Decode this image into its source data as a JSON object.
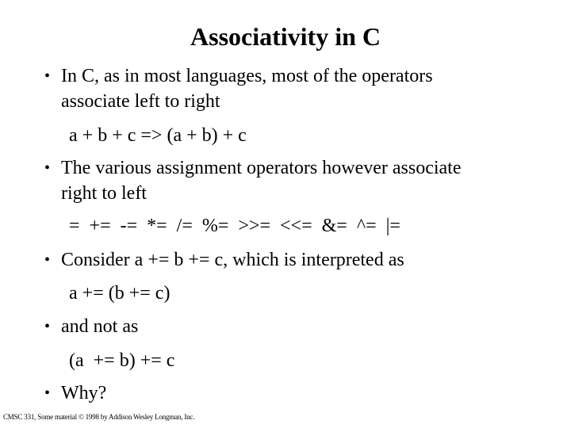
{
  "slide": {
    "title": "Associativity in C",
    "bullet_glyph": "•",
    "items": [
      {
        "type": "bullet",
        "lines": [
          "In C, as in most languages, most of the operators",
          "associate left to right"
        ]
      },
      {
        "type": "code",
        "text": "a + b + c => (a + b) + c"
      },
      {
        "type": "bullet",
        "lines": [
          "The various assignment operators however associate",
          "right to left"
        ]
      },
      {
        "type": "code",
        "text": "=  +=  -=  *=  /=  %=  >>=  <<=  &=  ^=  |="
      },
      {
        "type": "bullet",
        "lines": [
          "Consider a += b += c, which is interpreted as"
        ]
      },
      {
        "type": "code",
        "text": "a += (b += c)"
      },
      {
        "type": "bullet",
        "lines": [
          "and not as"
        ]
      },
      {
        "type": "code",
        "text": "(a  += b) += c"
      },
      {
        "type": "bullet",
        "lines": [
          "Why?"
        ]
      }
    ],
    "footer": "CMSC 331, Some material © 1998 by Addison Wesley Longman, Inc."
  }
}
